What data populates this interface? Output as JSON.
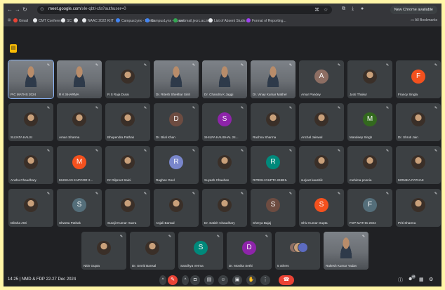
{
  "browser": {
    "url_domain": "meet.google.com",
    "url_path": "/xle-qbtl-cfa?authuser=0",
    "new_chrome_label": "New Chrome available",
    "bookmarks": [
      {
        "label": "Gmail",
        "color": "#ea4335"
      },
      {
        "label": "CMT Conference",
        "color": "#e8eaed"
      },
      {
        "label": "SC",
        "color": "#e8eaed"
      },
      {
        "label": "",
        "color": "#e8eaed"
      },
      {
        "label": "NAAC 2022 KIIT",
        "color": "#e8eaed"
      },
      {
        "label": "CampusLynx - Home",
        "color": "#4285f4"
      },
      {
        "label": "CampusLynx - Home",
        "color": "#4285f4"
      },
      {
        "label": "webmail.jecrc.ac.in",
        "color": "#34a853"
      },
      {
        "label": "List of Absent Stude...",
        "color": "#e8eaed"
      },
      {
        "label": "Format of Reporting...",
        "color": "#a142f4"
      }
    ],
    "all_bookmarks_label": "All Bookmarks"
  },
  "meet": {
    "badge_icon": "activities-icon",
    "participants": [
      {
        "name": "PIC MATHS 2024",
        "kind": "video"
      },
      {
        "name": "R K SHARMA",
        "kind": "video"
      },
      {
        "name": "R S Raja Durai",
        "kind": "photo"
      },
      {
        "name": "Dr. Ritesh Shekhar Sinha",
        "kind": "video"
      },
      {
        "name": "Dr. Chandra K Jaggi",
        "kind": "video"
      },
      {
        "name": "Dr. Vinay Kumar Mathematic",
        "kind": "video"
      },
      {
        "name": "Amar Pandey",
        "kind": "letter",
        "letter": "A",
        "color": "#8d6e63"
      },
      {
        "name": "Jyoti Thakur",
        "kind": "photo"
      },
      {
        "name": "Francy Singla",
        "kind": "letter",
        "letter": "F",
        "color": "#f4511e"
      },
      {
        "name": "SUJATA KALSI",
        "kind": "photo"
      },
      {
        "name": "Aman Sharma",
        "kind": "photo"
      },
      {
        "name": "Bhupendra Pathak",
        "kind": "photo"
      },
      {
        "name": "Dr. Bilal Khan",
        "kind": "letter",
        "letter": "D",
        "color": "#6d4c41"
      },
      {
        "name": "SHILPA KAUSHAL 24...",
        "kind": "letter",
        "letter": "S",
        "color": "#8e24aa"
      },
      {
        "name": "Rachna Sharma",
        "kind": "photo"
      },
      {
        "name": "Anchal Jaiswal",
        "kind": "photo"
      },
      {
        "name": "Mandeep Singh",
        "kind": "letter",
        "letter": "M",
        "color": "#33691e"
      },
      {
        "name": "Dr. Shruti Jain",
        "kind": "photo"
      },
      {
        "name": "Anshu Chaudhary",
        "kind": "photo"
      },
      {
        "name": "MUSKAN KAPOOR 2...",
        "kind": "letter",
        "letter": "M",
        "color": "#f4511e"
      },
      {
        "name": "Dr Dilpreet Saini",
        "kind": "photo"
      },
      {
        "name": "Raghav Goel",
        "kind": "letter",
        "letter": "R",
        "color": "#7986cb"
      },
      {
        "name": "Suyash Chauhan",
        "kind": "photo"
      },
      {
        "name": "RITESH GUPTA 246B14",
        "kind": "letter",
        "letter": "R",
        "color": "#00897b"
      },
      {
        "name": "surjeet kaushik",
        "kind": "photo"
      },
      {
        "name": "mehima poonia",
        "kind": "photo"
      },
      {
        "name": "MONIKA PATHAK",
        "kind": "photo"
      },
      {
        "name": "Diksha Attri",
        "kind": "photo"
      },
      {
        "name": "Shweta Pathak",
        "kind": "letter",
        "letter": "S",
        "color": "#546e7a"
      },
      {
        "name": "Surajit Kumar Hazra",
        "kind": "photo"
      },
      {
        "name": "Anjali Bansal",
        "kind": "photo"
      },
      {
        "name": "Dr. Satish Chaudhary",
        "kind": "photo"
      },
      {
        "name": "Shreya Bajaj",
        "kind": "letter",
        "letter": "S",
        "color": "#6d4c41"
      },
      {
        "name": "Shiv Kumar Gupta",
        "kind": "letter",
        "letter": "S",
        "color": "#f4511e"
      },
      {
        "name": "FDP MATHS 2024",
        "kind": "letter",
        "letter": "F",
        "color": "#546e7a"
      },
      {
        "name": "Priti Sharma",
        "kind": "photo"
      },
      {
        "name": "Nitin Gupta",
        "kind": "photo"
      },
      {
        "name": "Dr. Smriti Bansal",
        "kind": "photo"
      },
      {
        "name": "Sandhya Verma",
        "kind": "letter",
        "letter": "S",
        "color": "#00897b"
      },
      {
        "name": "Dr. Monika Sethi",
        "kind": "letter",
        "letter": "D",
        "color": "#8e24aa"
      },
      {
        "name": "5 others",
        "kind": "others"
      },
      {
        "name": "Rakesh Kumar Yadav",
        "kind": "video"
      }
    ]
  },
  "bottom": {
    "time": "14:25",
    "meeting_title": "NMD & FDP 22-27 Dec 2024",
    "participants_count": "48",
    "controls": [
      {
        "name": "more-options-icon",
        "glyph": "^"
      },
      {
        "name": "mic-off-icon",
        "glyph": "✎",
        "red": true
      },
      {
        "name": "camera-options-icon",
        "glyph": "^"
      },
      {
        "name": "camera-icon",
        "glyph": "◘"
      },
      {
        "name": "captions-icon",
        "glyph": "▤"
      },
      {
        "name": "emoji-icon",
        "glyph": "☺"
      },
      {
        "name": "present-icon",
        "glyph": "▣"
      },
      {
        "name": "raise-hand-icon",
        "glyph": "✋"
      },
      {
        "name": "more-vert-icon",
        "glyph": "⋮"
      },
      {
        "name": "end-call-icon",
        "glyph": "☎",
        "end": true
      }
    ]
  }
}
